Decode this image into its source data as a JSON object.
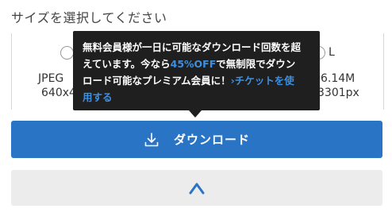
{
  "header": {
    "title": "サイズを選択してください"
  },
  "options": [
    {
      "format": "JPEG",
      "dimensions": "640x4"
    },
    {
      "label": "L",
      "file_size": "6.14M",
      "dimensions": "3301px"
    }
  ],
  "tooltip": {
    "line1": "無料会員様が一日に可能なダウンロード回数を超",
    "line2_pre": "えています。今なら",
    "line2_highlight": "45%OFF",
    "line2_post": "で無制限でダウン",
    "line3_pre": "ロード可能なプレミアム会員に！",
    "line3_link": "›チケットを使",
    "line4_link": "用する"
  },
  "download_button": {
    "label": "ダウンロード",
    "icon": "download-icon"
  },
  "collapse_button": {
    "icon": "chevron-up-icon"
  },
  "colors": {
    "primary": "#2a74c5",
    "tooltip_bg": "#1f1f1f",
    "accent": "#3d8fe0",
    "collapse_bg": "#ececec"
  }
}
